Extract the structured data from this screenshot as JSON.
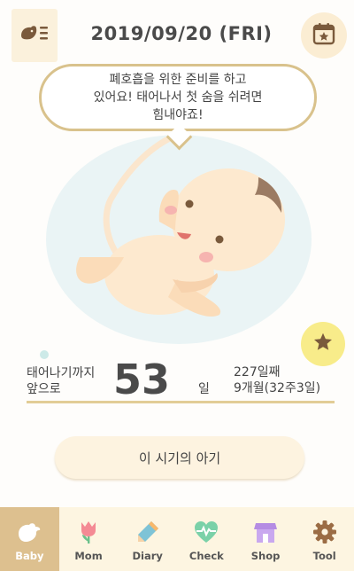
{
  "header": {
    "date": "2019/09/20 (FRI)",
    "menu_icon": "baby-menu-icon",
    "calendar_icon": "calendar-star-icon"
  },
  "bubble": {
    "message": "폐호흡을 위한 준비를 하고\n있어요! 태어나서 첫 숨을 쉬려면\n힘내야죠!"
  },
  "favorite_icon": "star-icon",
  "countdown": {
    "label": "태어나기까지\n앞으로",
    "days": "53",
    "unit": "일",
    "day_count": "227일째",
    "weeks": "9개월(32주3일)"
  },
  "period_button": "이 시기의 아기",
  "nav": {
    "items": [
      {
        "label": "Baby",
        "icon": "bird-icon",
        "active": true
      },
      {
        "label": "Mom",
        "icon": "tulip-icon",
        "active": false
      },
      {
        "label": "Diary",
        "icon": "pencil-icon",
        "active": false
      },
      {
        "label": "Check",
        "icon": "heart-pulse-icon",
        "active": false
      },
      {
        "label": "Shop",
        "icon": "store-icon",
        "active": false
      },
      {
        "label": "Tool",
        "icon": "gear-icon",
        "active": false
      }
    ]
  },
  "colors": {
    "accent": "#ddc08f",
    "bubble_border": "#d9c28c",
    "star_bg": "#f8ec8a",
    "circle_bg": "#eaf4f5"
  }
}
